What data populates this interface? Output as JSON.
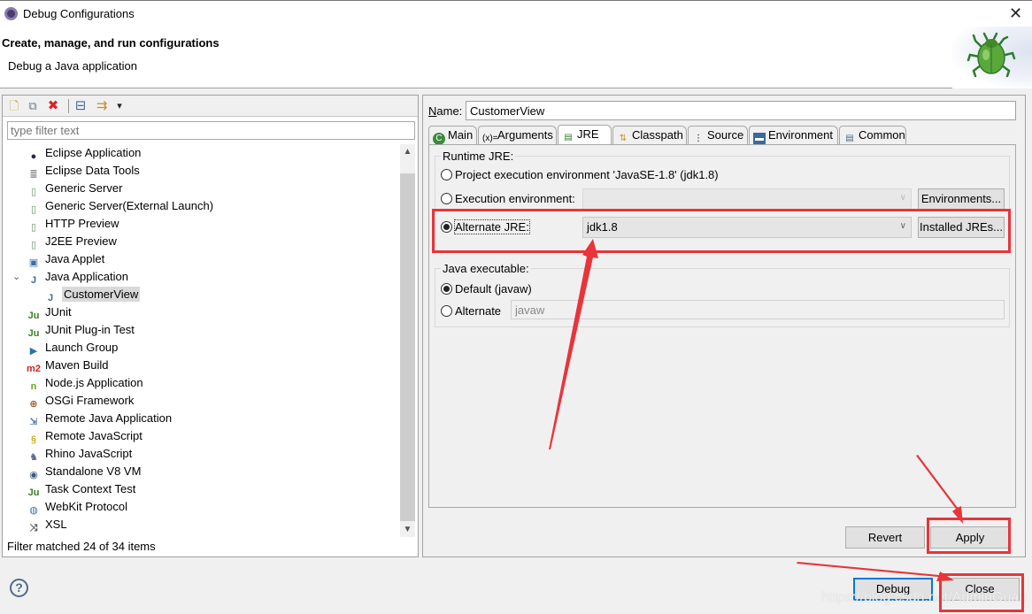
{
  "window": {
    "title": "Debug Configurations",
    "close_icon": "close-x-icon"
  },
  "banner": {
    "title": "Create, manage, and run configurations",
    "subtitle": "Debug a Java application",
    "image": "debug-bug-icon"
  },
  "left": {
    "toolbar": [
      {
        "name": "new-configuration",
        "icon": "new-file-icon",
        "glyph": "🗋"
      },
      {
        "name": "duplicate",
        "icon": "duplicate-icon",
        "glyph": "⧉"
      },
      {
        "name": "delete",
        "icon": "delete-x-icon",
        "glyph": "✖"
      },
      {
        "name": "collapse-all",
        "icon": "collapse-all-icon",
        "glyph": "⊟"
      },
      {
        "name": "filter",
        "icon": "filter-icon",
        "glyph": "⇉"
      },
      {
        "name": "view-menu",
        "icon": "dropdown-arrow-icon",
        "glyph": "▾"
      }
    ],
    "filter_placeholder": "type filter text",
    "tree": [
      {
        "label": "Eclipse Application",
        "icon": "eclipse-icon",
        "glyph": "●",
        "color": "#2c2255"
      },
      {
        "label": "Eclipse Data Tools",
        "icon": "database-icon",
        "glyph": "≣",
        "color": "#777777"
      },
      {
        "label": "Generic Server",
        "icon": "server-icon",
        "glyph": "▯",
        "color": "#6a8f6a"
      },
      {
        "label": "Generic Server(External Launch)",
        "icon": "server-icon",
        "glyph": "▯",
        "color": "#6a8f6a"
      },
      {
        "label": "HTTP Preview",
        "icon": "server-icon",
        "glyph": "▯",
        "color": "#6a8f6a"
      },
      {
        "label": "J2EE Preview",
        "icon": "server-icon",
        "glyph": "▯",
        "color": "#6a8f6a"
      },
      {
        "label": "Java Applet",
        "icon": "java-applet-icon",
        "glyph": "▣",
        "color": "#3a6ea5"
      },
      {
        "label": "Java Application",
        "icon": "java-app-icon",
        "glyph": "J",
        "color": "#3a6ea5",
        "expanded": true
      },
      {
        "label": "CustomerView",
        "icon": "java-app-icon",
        "glyph": "J",
        "color": "#3a6ea5",
        "child": true,
        "selected": true
      },
      {
        "label": "JUnit",
        "icon": "junit-icon",
        "glyph": "Ju",
        "color": "#3a7f2e"
      },
      {
        "label": "JUnit Plug-in Test",
        "icon": "junit-plugin-icon",
        "glyph": "Ju",
        "color": "#3a7f2e"
      },
      {
        "label": "Launch Group",
        "icon": "launch-group-icon",
        "glyph": "▶",
        "color": "#2f6fa8"
      },
      {
        "label": "Maven Build",
        "icon": "maven-icon",
        "glyph": "m2",
        "color": "#d0201f"
      },
      {
        "label": "Node.js Application",
        "icon": "nodejs-icon",
        "glyph": "n",
        "color": "#6aa32a"
      },
      {
        "label": "OSGi Framework",
        "icon": "osgi-icon",
        "glyph": "⊕",
        "color": "#a0522d"
      },
      {
        "label": "Remote Java Application",
        "icon": "remote-java-icon",
        "glyph": "⇲",
        "color": "#3a6ea5"
      },
      {
        "label": "Remote JavaScript",
        "icon": "remote-js-icon",
        "glyph": "§",
        "color": "#c8b020"
      },
      {
        "label": "Rhino JavaScript",
        "icon": "rhino-icon",
        "glyph": "♞",
        "color": "#5a6a8a"
      },
      {
        "label": "Standalone V8 VM",
        "icon": "v8-icon",
        "glyph": "◉",
        "color": "#3a5a7a"
      },
      {
        "label": "Task Context Test",
        "icon": "task-context-icon",
        "glyph": "Ju",
        "color": "#3a7f2e"
      },
      {
        "label": "WebKit Protocol",
        "icon": "webkit-icon",
        "glyph": "◍",
        "color": "#3a70b0"
      },
      {
        "label": "XSL",
        "icon": "xsl-icon",
        "glyph": "⤨",
        "color": "#555555"
      }
    ],
    "status": "Filter matched 24 of 34 items"
  },
  "right": {
    "name_label": "Name:",
    "name_value": "CustomerView",
    "tabs": [
      {
        "label": "Main",
        "icon": "main-tab-icon",
        "glyph": "C",
        "active": false
      },
      {
        "label": "Arguments",
        "icon": "arguments-icon",
        "glyph": "(x)=",
        "active": false
      },
      {
        "label": "JRE",
        "icon": "jre-icon",
        "glyph": "▤",
        "active": true
      },
      {
        "label": "Classpath",
        "icon": "classpath-icon",
        "glyph": "⇅",
        "active": false
      },
      {
        "label": "Source",
        "icon": "source-icon",
        "glyph": "⋮",
        "active": false
      },
      {
        "label": "Environment",
        "icon": "environment-icon",
        "glyph": "▬",
        "active": false
      },
      {
        "label": "Common",
        "icon": "common-icon",
        "glyph": "▤",
        "active": false
      }
    ],
    "runtime_jre": {
      "group_label": "Runtime JRE:",
      "project_env_label": "Project execution environment 'JavaSE-1.8' (jdk1.8)",
      "execution_env_label": "Execution environment:",
      "execution_env_value": "",
      "environments_button": "Environments...",
      "alternate_jre_label": "Alternate JRE:",
      "alternate_jre_value": "jdk1.8",
      "installed_jres_button": "Installed JREs...",
      "selected": "alternate"
    },
    "java_executable": {
      "group_label": "Java executable:",
      "default_label": "Default (javaw)",
      "alternate_label": "Alternate",
      "alternate_value": "javaw",
      "selected": "default"
    },
    "revert_button": "Revert",
    "apply_button": "Apply"
  },
  "footer": {
    "help_icon": "help-question-icon",
    "debug_button": "Debug",
    "close_button": "Close",
    "watermark": "https://blog.csdn.net/AdminGuan"
  },
  "annotations": {
    "color": "#e8343a"
  }
}
